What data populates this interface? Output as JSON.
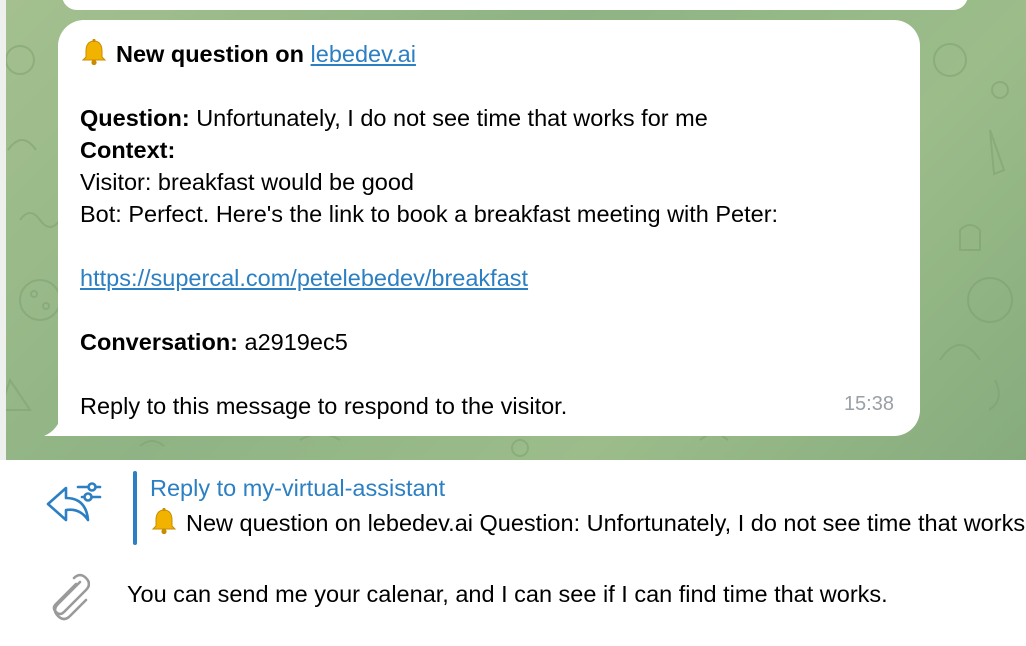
{
  "message": {
    "bell_icon": "bell-icon",
    "header_prefix": "New question on ",
    "header_link": "lebedev.ai",
    "question_label": "Question:",
    "question_text": " Unfortunately, I do not see time that works for me",
    "context_label": "Context:",
    "visitor_line": "Visitor: breakfast would be good",
    "bot_line": "Bot: Perfect. Here's the link to book a breakfast meeting with Peter:",
    "booking_link": "https://supercal.com/petelebedev/breakfast",
    "conversation_label": "Conversation:",
    "conversation_id": " a2919ec5",
    "footer_text": "Reply to this message to respond to the visitor.",
    "timestamp": "15:38"
  },
  "composer": {
    "reply_title": "Reply to my-virtual-assistant",
    "reply_preview": "New question on lebedev.ai  Question: Unfortunately, I do not see time that works for me",
    "input_text": "You can send me your calenar, and I can see if I can find time that works."
  },
  "colors": {
    "accent": "#2b7fc2",
    "chat_background": "#9cbd8a",
    "bubble": "#ffffff",
    "timestamp": "#9aa0a6"
  }
}
